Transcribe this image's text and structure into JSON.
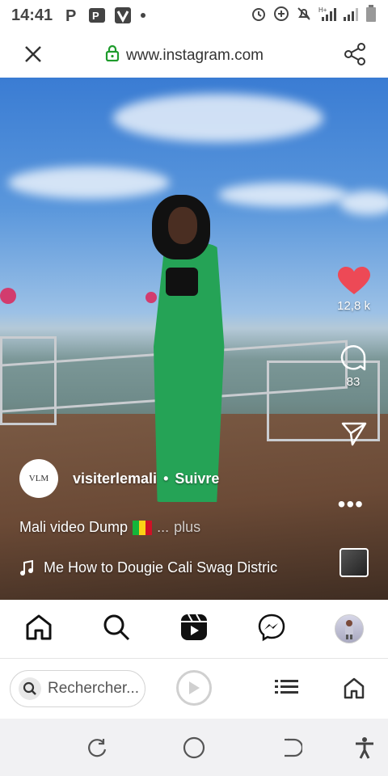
{
  "status_bar": {
    "time": "14:41",
    "left_icons": [
      "parking-icon",
      "park-app-icon",
      "v-app-icon",
      "notification-dot"
    ],
    "right_icons": [
      "alarm-icon",
      "data-saver-icon",
      "mute-icon",
      "network-signal",
      "signal-bars",
      "battery-icon"
    ],
    "network_type": "H+"
  },
  "browser": {
    "url": "www.instagram.com",
    "close_icon": "close-icon",
    "share_icon": "share-icon"
  },
  "reel": {
    "likes": "12,8 k",
    "comments": "83",
    "author": {
      "username": "visiterlemali",
      "avatar_text": "VLM",
      "follow_label": "Suivre",
      "separator": "•"
    },
    "caption": {
      "text": "Mali video Dump",
      "ellipsis": "...",
      "more_label": "plus",
      "flag_colors": [
        "#14b53a",
        "#fcd116",
        "#ce1126"
      ]
    },
    "music": {
      "track": "Me How to Dougie  Cali Swag Distric"
    },
    "like_color": "#ed4956"
  },
  "instagram_nav": [
    "home-icon",
    "search-icon",
    "reels-icon",
    "messenger-icon",
    "profile-avatar"
  ],
  "browser_bar": {
    "search_placeholder": "Rechercher...",
    "play_icon": "play-icon",
    "list_icon": "list-icon",
    "home_icon": "home-icon"
  },
  "android_nav": [
    "recents-icon",
    "home-circle-icon",
    "back-icon",
    "accessibility-icon"
  ]
}
